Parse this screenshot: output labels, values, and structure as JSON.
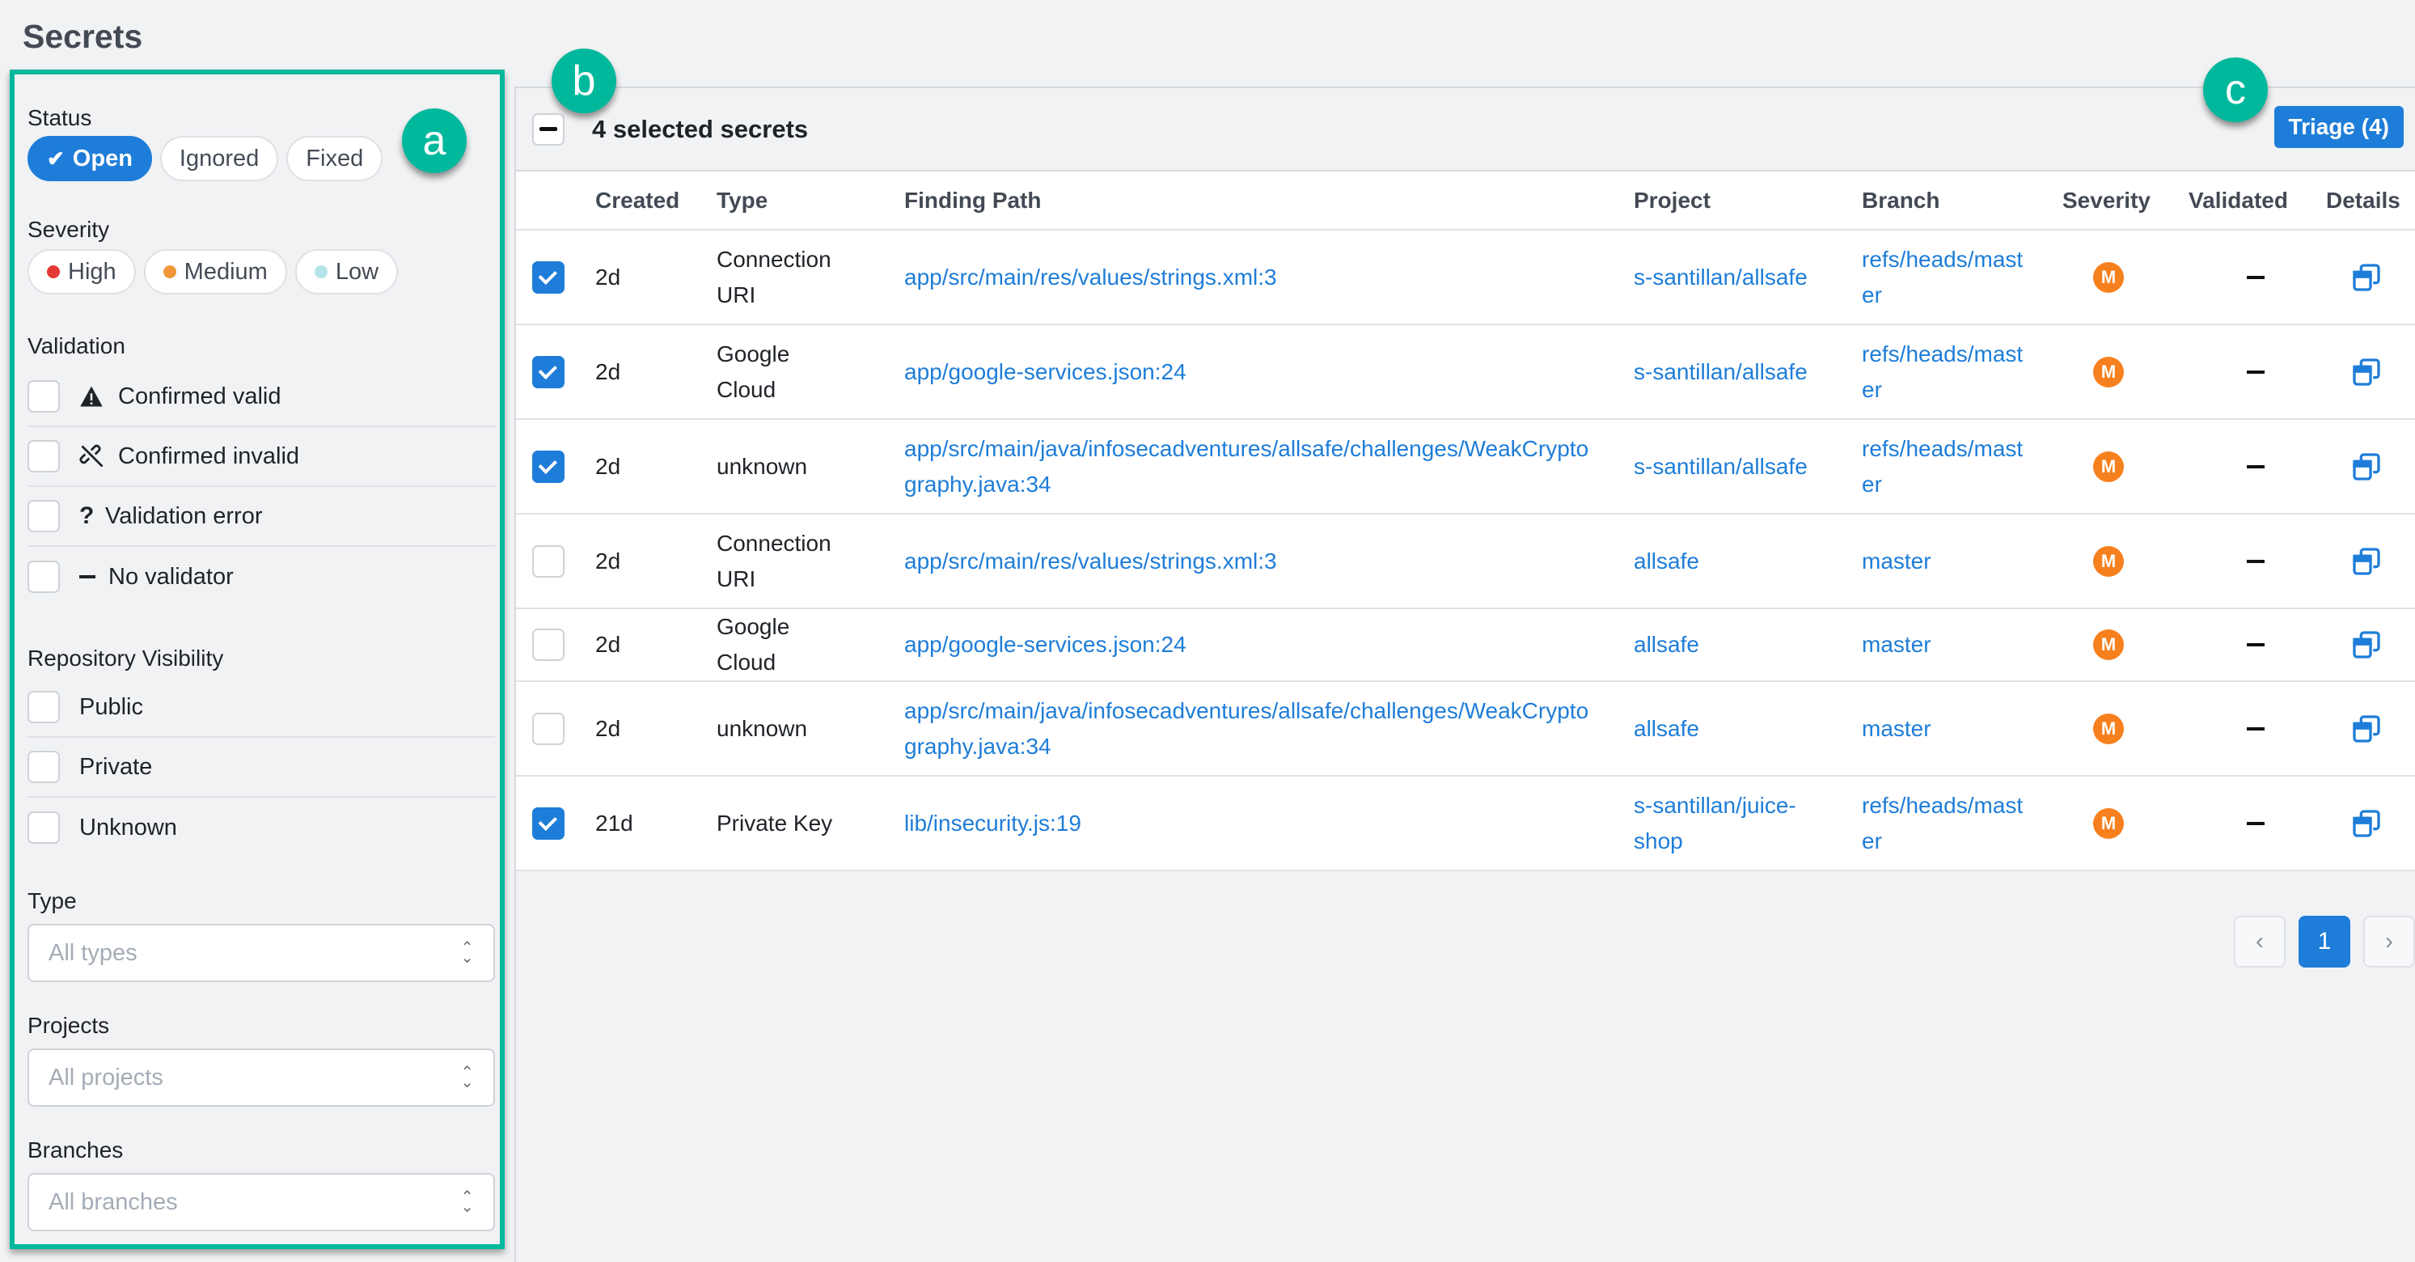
{
  "page": {
    "title": "Secrets"
  },
  "callouts": {
    "a": "a",
    "b": "b",
    "c": "c"
  },
  "filters": {
    "status": {
      "label": "Status",
      "options": [
        {
          "label": "Open",
          "active": true
        },
        {
          "label": "Ignored",
          "active": false
        },
        {
          "label": "Fixed",
          "active": false
        }
      ]
    },
    "severity": {
      "label": "Severity",
      "options": [
        {
          "label": "High",
          "color": "#e53935"
        },
        {
          "label": "Medium",
          "color": "#f0973a"
        },
        {
          "label": "Low",
          "color": "#b2e4ea"
        }
      ]
    },
    "validation": {
      "label": "Validation",
      "items": [
        {
          "label": "Confirmed valid",
          "icon": "warning-icon",
          "checked": false
        },
        {
          "label": "Confirmed invalid",
          "icon": "broken-link-icon",
          "checked": false
        },
        {
          "label": "Validation error",
          "icon": "question-icon",
          "checked": false
        },
        {
          "label": "No validator",
          "icon": "dash-icon",
          "checked": false
        }
      ]
    },
    "visibility": {
      "label": "Repository Visibility",
      "items": [
        {
          "label": "Public",
          "checked": false
        },
        {
          "label": "Private",
          "checked": false
        },
        {
          "label": "Unknown",
          "checked": false
        }
      ]
    },
    "type": {
      "label": "Type",
      "placeholder": "All types"
    },
    "projects": {
      "label": "Projects",
      "placeholder": "All projects"
    },
    "branches": {
      "label": "Branches",
      "placeholder": "All branches"
    }
  },
  "selection": {
    "text": "4 selected secrets",
    "triage_label": "Triage (4)"
  },
  "table": {
    "columns": [
      "Created",
      "Type",
      "Finding Path",
      "Project",
      "Branch",
      "Severity",
      "Validated",
      "Details"
    ],
    "rows": [
      {
        "checked": true,
        "created": "2d",
        "type": "Connection URI",
        "path": "app/src/main/res/values/strings.xml:3",
        "project": "s-santillan/allsafe",
        "branch": "refs/heads/master",
        "severity": "M",
        "validated": "—"
      },
      {
        "checked": true,
        "created": "2d",
        "type": "Google Cloud",
        "path": "app/google-services.json:24",
        "project": "s-santillan/allsafe",
        "branch": "refs/heads/master",
        "severity": "M",
        "validated": "—"
      },
      {
        "checked": true,
        "created": "2d",
        "type": "unknown",
        "path": "app/src/main/java/infosecadventures/allsafe/challenges/WeakCryptography.java:34",
        "project": "s-santillan/allsafe",
        "branch": "refs/heads/master",
        "severity": "M",
        "validated": "—"
      },
      {
        "checked": false,
        "created": "2d",
        "type": "Connection URI",
        "path": "app/src/main/res/values/strings.xml:3",
        "project": "allsafe",
        "branch": "master",
        "severity": "M",
        "validated": "—"
      },
      {
        "checked": false,
        "created": "2d",
        "type": "Google Cloud",
        "path": "app/google-services.json:24",
        "project": "allsafe",
        "branch": "master",
        "severity": "M",
        "validated": "—"
      },
      {
        "checked": false,
        "created": "2d",
        "type": "unknown",
        "path": "app/src/main/java/infosecadventures/allsafe/challenges/WeakCryptography.java:34",
        "project": "allsafe",
        "branch": "master",
        "severity": "M",
        "validated": "—"
      },
      {
        "checked": true,
        "created": "21d",
        "type": "Private Key",
        "path": "lib/insecurity.js:19",
        "project": "s-santillan/juice-shop",
        "branch": "refs/heads/master",
        "severity": "M",
        "validated": "—"
      }
    ]
  },
  "pagination": {
    "prev": "‹",
    "current": "1",
    "next": "›"
  },
  "colors": {
    "accent": "#1e7dd8",
    "callout": "#00b89c",
    "severity_medium": "#f7801e"
  }
}
